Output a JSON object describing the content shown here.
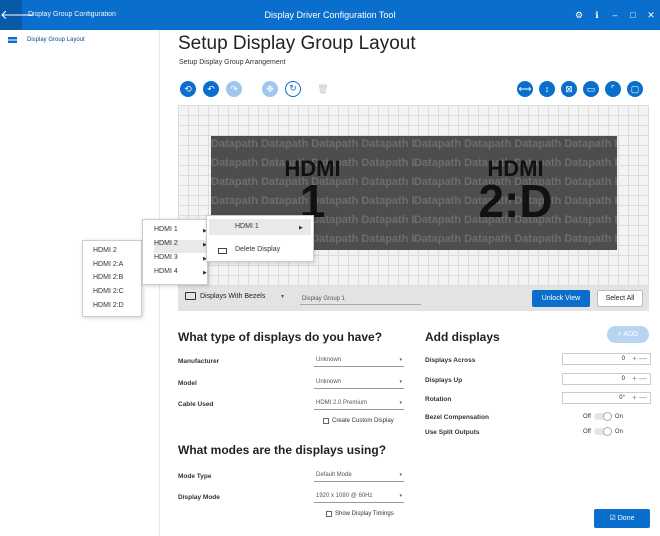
{
  "titlebar": {
    "back_glyph": "🡐",
    "left_label": "Display Group Configuration",
    "title": "Display Driver Configuration Tool",
    "controls": [
      "⚙",
      "ℹ",
      "–",
      "□",
      "✕"
    ]
  },
  "sidebar": {
    "items": [
      {
        "label": "Display Group Layout"
      }
    ]
  },
  "main": {
    "title": "Setup Display Group Layout",
    "subtitle": "Setup Display Group Arrangement"
  },
  "toolbar": {
    "left": [
      {
        "glyph": "⟲",
        "icon": "history-icon"
      },
      {
        "glyph": "↶",
        "icon": "undo-icon"
      },
      {
        "glyph": "↷",
        "icon": "redo-icon"
      },
      {
        "glyph": "✥",
        "icon": "move-icon"
      },
      {
        "glyph": "↻",
        "icon": "rotate-icon"
      },
      {
        "glyph": "🗑",
        "icon": "trash-icon"
      }
    ],
    "right": [
      {
        "glyph": "⟷",
        "icon": "fit-width-icon"
      },
      {
        "glyph": "↕",
        "icon": "fit-height-icon"
      },
      {
        "glyph": "⊠",
        "icon": "grid-icon"
      },
      {
        "glyph": "▭",
        "icon": "display-icon"
      },
      {
        "glyph": "⌜",
        "icon": "corner-icon"
      },
      {
        "glyph": "▢",
        "icon": "fullscreen-icon"
      }
    ]
  },
  "canvas": {
    "watermark": "Datapath",
    "displays": [
      {
        "line1": "HDMI",
        "line2": "1"
      },
      {
        "line1": "HDMI",
        "line2": "2:D"
      }
    ]
  },
  "view_bar": {
    "bezel_label": "Displays With Bezels",
    "dropdown_caret": "▾",
    "group_name": "Display Group 1",
    "unlock_label": "Unlock View",
    "select_all_label": "Select All"
  },
  "context_menus": {
    "primary": {
      "items": [
        "HDMI 1",
        "Delete Display"
      ]
    },
    "ports": {
      "items": [
        "HDMI 1",
        "HDMI 2",
        "HDMI 3",
        "HDMI 4"
      ]
    },
    "subports": {
      "items": [
        "HDMI 2",
        "HDMI 2:A",
        "HDMI 2:B",
        "HDMI 2:C",
        "HDMI 2:D"
      ]
    },
    "arrow_glyph": "▶"
  },
  "displays_section": {
    "heading": "What type of displays do you have?",
    "fields": [
      {
        "label": "Manufacturer",
        "value": "Unknown"
      },
      {
        "label": "Model",
        "value": "Unknown"
      },
      {
        "label": "Cable Used",
        "value": "HDMI 2.0 Premium"
      }
    ],
    "checkbox_label": "Create Custom Display"
  },
  "modes_section": {
    "heading": "What modes are the displays using?",
    "fields": [
      {
        "label": "Mode Type",
        "value": "Default Mode"
      },
      {
        "label": "Display Mode",
        "value": "1920 x 1080 @ 60Hz"
      }
    ],
    "checkbox_label": "Show Display Timings"
  },
  "add_section": {
    "heading": "Add displays",
    "add_label": "+ ADD",
    "steppers": [
      {
        "label": "Displays Across",
        "value": "0"
      },
      {
        "label": "Displays Up",
        "value": "0"
      },
      {
        "label": "Rotation",
        "value": "0°"
      }
    ],
    "stepper_glyph": "+ —",
    "toggles": [
      {
        "label": "Bezel Compensation",
        "off": "Off",
        "on": "On"
      },
      {
        "label": "Use Split Outputs",
        "off": "Off",
        "on": "On"
      }
    ]
  },
  "done_label": "☑ Done",
  "colors": {
    "accent": "#0a6fcc",
    "display": "#4d4d4d",
    "grid": "#dcdcdc"
  }
}
